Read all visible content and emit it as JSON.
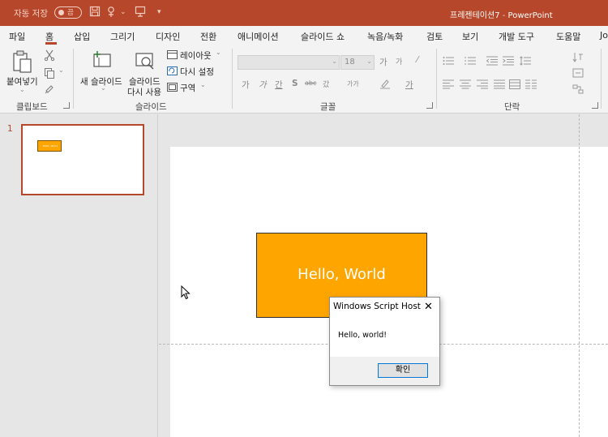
{
  "titlebar": {
    "autosave_label": "자동 저장",
    "autosave_state": "끔",
    "window_title": "프레젠테이션7",
    "separator": "-",
    "app_name": "PowerPoint",
    "bg_color": "#b7472a"
  },
  "tabs": [
    "파일",
    "홈",
    "삽입",
    "그리기",
    "디자인",
    "전환",
    "애니메이션",
    "슬라이드 쇼",
    "녹음/녹화",
    "검토",
    "보기",
    "개발 도구",
    "도움말",
    "Jo"
  ],
  "active_tab": "홈",
  "ribbon": {
    "clipboard": {
      "paste_label": "붙여넣기",
      "group_label": "클립보드"
    },
    "slides": {
      "new_slide_label": "새 슬라이드",
      "reuse_label_1": "슬라이드",
      "reuse_label_2": "다시 사용",
      "layout_label": "레이아웃",
      "reset_label": "다시 설정",
      "section_label": "구역",
      "group_label": "슬라이드"
    },
    "font": {
      "font_size": "18",
      "grow": "가",
      "shrink": "가",
      "bold": "가",
      "italic": "가",
      "underline": "간",
      "shadow": "S",
      "strike": "abc",
      "spacing": "갔",
      "case": "가가",
      "font_color": "가",
      "group_label": "글꼴"
    },
    "paragraph": {
      "group_label": "단락"
    }
  },
  "slide_pane": {
    "slide_number": "1",
    "thumb_text": "Hello, World"
  },
  "slide": {
    "shape_text": "Hello, World",
    "shape_color": "#ffa500"
  },
  "dialog": {
    "title": "Windows Script Host",
    "close_glyph": "✕",
    "message": "Hello, world!",
    "ok_label": "확인"
  }
}
